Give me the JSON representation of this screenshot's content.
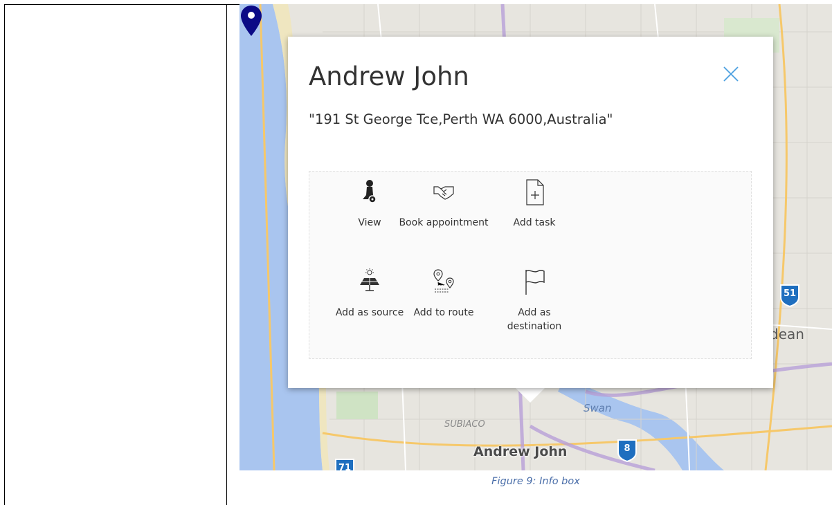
{
  "infobox": {
    "title": "Andrew John",
    "address": "\"191 St George Tce,Perth WA 6000,Australia\"",
    "actions": [
      {
        "label": "View",
        "icon": "person-pin-icon"
      },
      {
        "label": "Book appointment",
        "icon": "handshake-icon"
      },
      {
        "label": "Add task",
        "icon": "add-task-icon"
      },
      {
        "label": "Add as source",
        "icon": "solar-panel-icon"
      },
      {
        "label": "Add to route",
        "icon": "route-icon"
      },
      {
        "label": "Add as destination",
        "icon": "flag-icon"
      }
    ],
    "close_icon": "close-icon"
  },
  "map": {
    "pin_label": "Andrew John",
    "place_subiaco": "SUBIACO",
    "place_swan": "Swan",
    "place_partial": "dean",
    "shields": [
      "51",
      "8",
      "71"
    ],
    "pin_color": "#0b0b86",
    "water_color": "#a9c5ef",
    "shield_color": "#1f6fbf"
  },
  "caption": "Figure 9: Info box"
}
